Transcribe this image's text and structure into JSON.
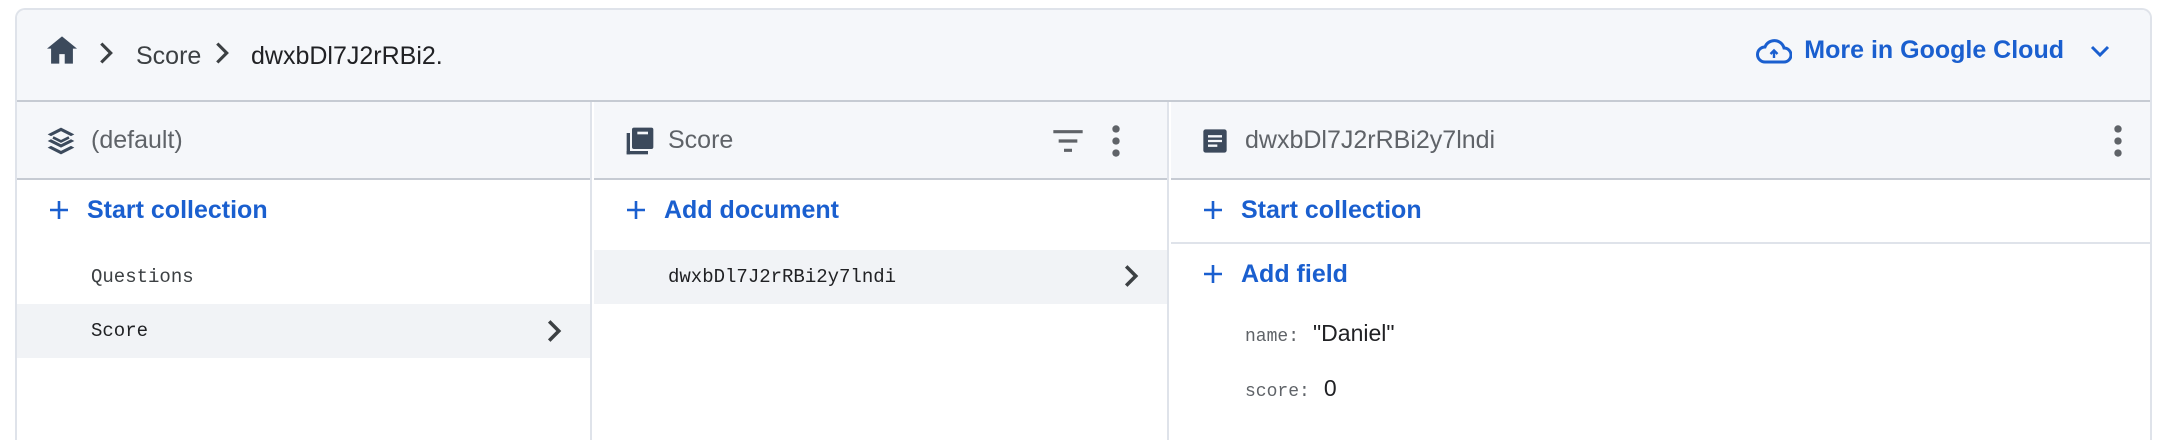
{
  "breadcrumb": {
    "home_icon": "home-icon",
    "items": [
      "Score",
      "dwxbDl7J2rRBi2."
    ]
  },
  "cloud": {
    "label": "More in Google Cloud",
    "icon": "cloud-icon",
    "accent": "#1a5fcf"
  },
  "columns": {
    "root": {
      "title": "(default)",
      "icon": "database-stack-icon",
      "action": "Start collection",
      "items": [
        {
          "label": "Questions",
          "selected": false
        },
        {
          "label": "Score",
          "selected": true
        }
      ]
    },
    "collection": {
      "title": "Score",
      "icon": "collection-icon",
      "action": "Add document",
      "items": [
        {
          "label": "dwxbDl7J2rRBi2y7lndi",
          "selected": true
        }
      ]
    },
    "document": {
      "title": "dwxbDl7J2rRBi2y7lndi",
      "icon": "document-icon",
      "action_collection": "Start collection",
      "action_field": "Add field",
      "fields": [
        {
          "key": "name:",
          "value": "\"Daniel\""
        },
        {
          "key": "score:",
          "value": "0"
        }
      ]
    }
  }
}
